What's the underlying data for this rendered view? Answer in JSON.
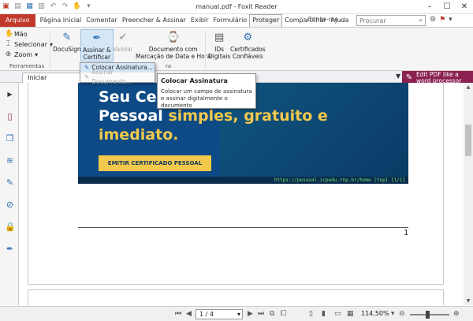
{
  "window": {
    "title": "manual.pdf - Foxit Reader"
  },
  "quick_access": [
    "app-logo-icon",
    "open-icon",
    "save-icon",
    "print-icon",
    "undo-icon",
    "redo-icon",
    "hand-icon",
    "dropdown-icon"
  ],
  "tabs": [
    "Arquivo",
    "Página Inicial",
    "Comentar",
    "Preencher & Assinar",
    "Exibir",
    "Formulário",
    "Proteger",
    "Compartilhar",
    "Ajuda"
  ],
  "active_tab": "Proteger",
  "tell_me": "Conte-me...",
  "search": {
    "placeholder": "Procurar"
  },
  "ribbon": {
    "tools": {
      "hand": "Mão",
      "select": "Selecionar",
      "zoom": "Zoom"
    },
    "group_tools": "Ferramentas",
    "docusign": "DocuSign",
    "sign_certify": [
      "Assinar &",
      "Certificar"
    ],
    "validate": "Validar",
    "timestamp": [
      "Documento com",
      "Marcação de Data e Hora"
    ],
    "digital_ids": [
      "IDs",
      "Digitais"
    ],
    "trusted_certs": [
      "Certificados",
      "Confiáveis"
    ],
    "group_protect_tail": "ra"
  },
  "doc_tab": "Iniciar",
  "promo": [
    "Edit PDF like a",
    "word processor"
  ],
  "dropdown_menu": {
    "items": [
      {
        "label": "Colocar Assinatura...",
        "enabled": true
      },
      {
        "label": "Assinar Documento...",
        "enabled": false
      }
    ]
  },
  "tooltip": {
    "title": "Colocar Assinatura",
    "body": "Colocar um campo de assinatura e assinar digitalmente o documento"
  },
  "page_content": {
    "line1": "Seu Cert",
    "line2_white": "Pessoal ",
    "line2_yellow": "simples, gratuito e",
    "line3": "imediato.",
    "button": "EMITIR CERTIFICADO PESSOAL",
    "url": "https://pessoal.icpedu.rnp.br/home [top] [1/1]",
    "page_number": "1"
  },
  "status": {
    "page": "1 / 4",
    "zoom": "114,50%"
  },
  "colors": {
    "file_tab": "#c0392b",
    "promo": "#8b2150",
    "banner": "#0e4a85",
    "highlight": "#f2c94c"
  }
}
